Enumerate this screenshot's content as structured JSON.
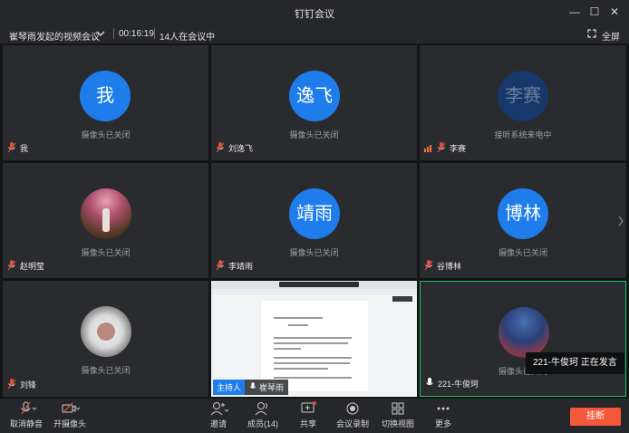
{
  "window": {
    "title": "钉钉会议"
  },
  "info": {
    "meeting_name": "崔琴雨发起的视频会议",
    "duration": "00:16:19",
    "participants": "14人在会议中",
    "fullscreen_label": "全屏"
  },
  "tiles": [
    {
      "avatar_text": "我",
      "status": "摄像头已关闭",
      "name": "我"
    },
    {
      "avatar_text": "逸飞",
      "status": "摄像头已关闭",
      "name": "刘逸飞"
    },
    {
      "avatar_text": "李赛",
      "status": "接听系统来电中",
      "name": "李赛"
    },
    {
      "status": "摄像头已关闭",
      "name": "赵明莹"
    },
    {
      "avatar_text": "靖雨",
      "status": "摄像头已关闭",
      "name": "李靖雨"
    },
    {
      "avatar_text": "博林",
      "status": "摄像头已关闭",
      "name": "谷博林"
    },
    {
      "status": "摄像头已关闭",
      "name": "刘锋"
    },
    {
      "host_badge": "主持人",
      "name": "崔琴雨"
    },
    {
      "status": "摄像头已关闭",
      "name": "221-牛俊珂",
      "speaking": "221-牛俊珂  正在发言"
    }
  ],
  "toolbar": {
    "mute": "取消静音",
    "camera": "开摄像头",
    "invite": "邀请",
    "members": "成员(14)",
    "share": "共享",
    "record": "会议录制",
    "switch_view": "切换视图",
    "more": "更多",
    "hang_up": "挂断"
  },
  "colors": {
    "accent_blue": "#1e7dea",
    "speaker_green": "#1fbf6b",
    "hangup": "#f5583a"
  }
}
